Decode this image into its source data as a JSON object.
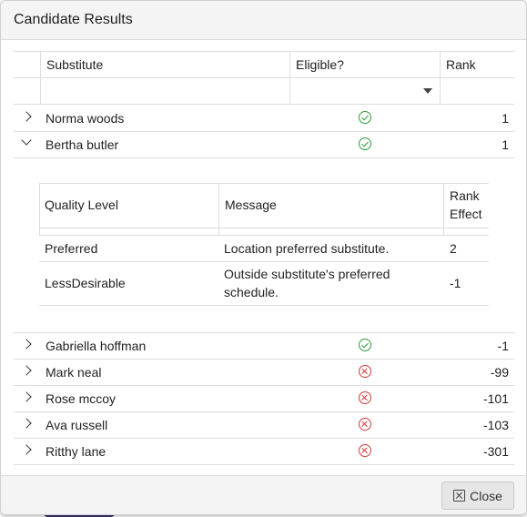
{
  "dialog": {
    "title": "Candidate Results",
    "close_label": "Close"
  },
  "grid": {
    "columns": [
      "Substitute",
      "Eligible?",
      "Rank"
    ],
    "rows": [
      {
        "name": "Norma woods",
        "eligible": true,
        "rank": "1",
        "expanded": false
      },
      {
        "name": "Bertha butler",
        "eligible": true,
        "rank": "1",
        "expanded": true
      },
      {
        "name": "Gabriella hoffman",
        "eligible": true,
        "rank": "-1",
        "expanded": false
      },
      {
        "name": "Mark neal",
        "eligible": false,
        "rank": "-99",
        "expanded": false
      },
      {
        "name": "Rose mccoy",
        "eligible": false,
        "rank": "-101",
        "expanded": false
      },
      {
        "name": "Ava russell",
        "eligible": false,
        "rank": "-103",
        "expanded": false
      },
      {
        "name": "Ritthy lane",
        "eligible": false,
        "rank": "-301",
        "expanded": false
      }
    ]
  },
  "detail": {
    "columns": [
      "Quality Level",
      "Message",
      "Rank Effect"
    ],
    "rank_effect_lines": [
      "Rank",
      "Effect"
    ],
    "rows": [
      {
        "quality": "Preferred",
        "message_lines": [
          "Location preferred substitute."
        ],
        "effect": "2"
      },
      {
        "quality": "LessDesirable",
        "message_lines": [
          "Outside substitute's preferred",
          "schedule."
        ],
        "effect": "-1"
      }
    ]
  },
  "icons": {
    "eligible_yes": "check-circle-icon",
    "eligible_no": "x-circle-icon",
    "collapsed": "chevron-right-icon",
    "expanded": "chevron-down-icon"
  },
  "colors": {
    "ok": "#2e9a3a",
    "bad": "#d33a3a",
    "header_bg": "#f4f4f4",
    "close_button_bg": "#e6e6e6"
  }
}
